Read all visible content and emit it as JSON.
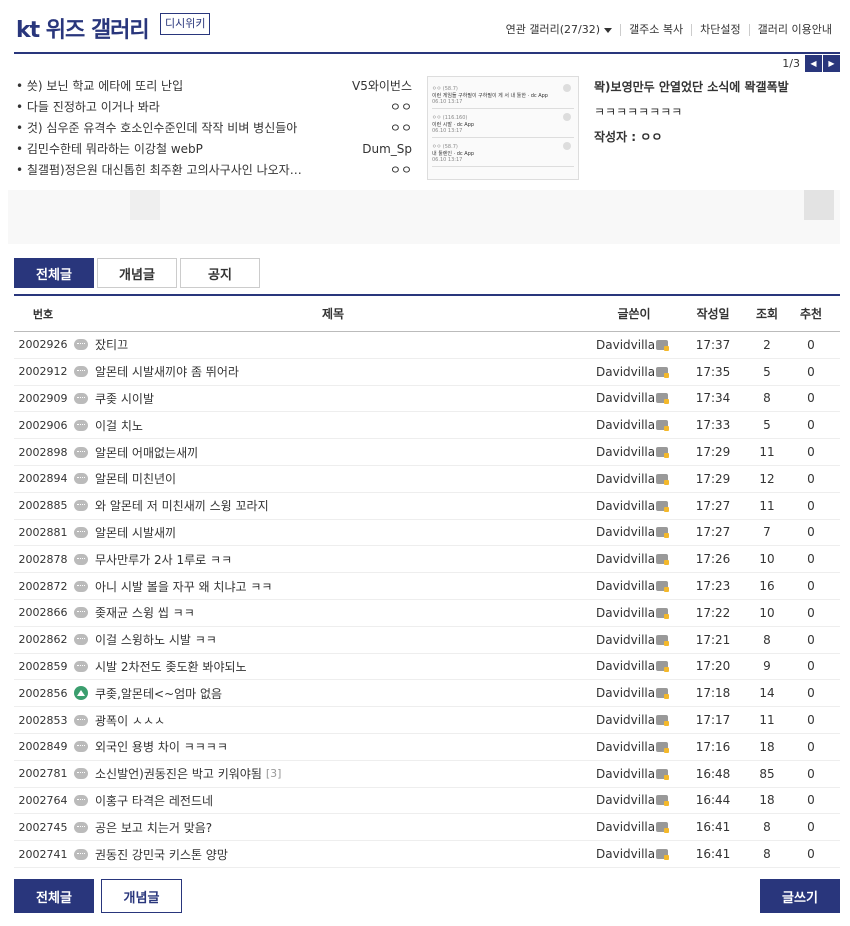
{
  "header": {
    "title": "kt 위즈 갤러리",
    "wiki_badge": "디시위키",
    "links": [
      "연관 갤러리(27/32)",
      "갤주소 복사",
      "차단설정",
      "갤러리 이용안내"
    ]
  },
  "pager": {
    "count": "1/3"
  },
  "hot_posts": [
    {
      "title": "• 씃) 보닌 학교 에타에 또리 난입",
      "author": "V5와이번스"
    },
    {
      "title": "• 다들 진정하고 이거나 봐라",
      "author": "ㅇㅇ"
    },
    {
      "title": "• 것) 심우준 유격수 호소인수준인데 작작 비벼 병신들아",
      "author": "ㅇㅇ"
    },
    {
      "title": "• 김민수한테 뭐라하는 이강철 webP",
      "author": "Dum_Sp"
    },
    {
      "title": "• 칠갤펌)정은원 대신톱힌 최주환 고의사구사인 나오자…",
      "author": "ㅇㅇ"
    }
  ],
  "thumb_cards": [
    {
      "l1": "ㅇㅇ (58.7)",
      "l2": "이런 게임들 구하필이 구하필이 게 서 내 툴한 · dc App",
      "l3": "06.10 13:17"
    },
    {
      "l1": "ㅇㅇ (116.160)",
      "l2": "이런 시발 · dc App",
      "l3": "06.10 13:17"
    },
    {
      "l1": "ㅇㅇ (58.7)",
      "l2": "내 툴렌인 · dc App",
      "l3": "06.10 13:17"
    }
  ],
  "feature": {
    "title": "뫅)보영만두 안열었단 소식에 뫅갤폭발",
    "body": "ㅋㅋㅋㅋㅋㅋㅋㅋ",
    "author": "작성자 : ㅇㅇ"
  },
  "tabs": [
    "전체글",
    "개념글",
    "공지"
  ],
  "columns": {
    "num": "번호",
    "subject": "제목",
    "writer": "글쓴이",
    "date": "작성일",
    "views": "조회",
    "recommend": "추천"
  },
  "rows": [
    {
      "num": "2002926",
      "subject": "잤티끄",
      "reply": "",
      "writer": "Davidvilla",
      "date": "17:37",
      "views": "2",
      "rec": "0",
      "img": false
    },
    {
      "num": "2002912",
      "subject": "알몬테 시발새끼야 좀 뛰어라",
      "reply": "",
      "writer": "Davidvilla",
      "date": "17:35",
      "views": "5",
      "rec": "0",
      "img": false
    },
    {
      "num": "2002909",
      "subject": "쿠좆 시이발",
      "reply": "",
      "writer": "Davidvilla",
      "date": "17:34",
      "views": "8",
      "rec": "0",
      "img": false
    },
    {
      "num": "2002906",
      "subject": "이걸 치노",
      "reply": "",
      "writer": "Davidvilla",
      "date": "17:33",
      "views": "5",
      "rec": "0",
      "img": false
    },
    {
      "num": "2002898",
      "subject": "알몬테 어매없는새끼",
      "reply": "",
      "writer": "Davidvilla",
      "date": "17:29",
      "views": "11",
      "rec": "0",
      "img": false
    },
    {
      "num": "2002894",
      "subject": "알몬테 미친년이",
      "reply": "",
      "writer": "Davidvilla",
      "date": "17:29",
      "views": "12",
      "rec": "0",
      "img": false
    },
    {
      "num": "2002885",
      "subject": "와 알몬테 저 미친새끼 스윙 꼬라지",
      "reply": "",
      "writer": "Davidvilla",
      "date": "17:27",
      "views": "11",
      "rec": "0",
      "img": false
    },
    {
      "num": "2002881",
      "subject": "알몬테 시발새끼",
      "reply": "",
      "writer": "Davidvilla",
      "date": "17:27",
      "views": "7",
      "rec": "0",
      "img": false
    },
    {
      "num": "2002878",
      "subject": "무사만루가 2사 1루로 ㅋㅋ",
      "reply": "",
      "writer": "Davidvilla",
      "date": "17:26",
      "views": "10",
      "rec": "0",
      "img": false
    },
    {
      "num": "2002872",
      "subject": "아니 시발 볼을 자꾸 왜 치냐고 ㅋㅋ",
      "reply": "",
      "writer": "Davidvilla",
      "date": "17:23",
      "views": "16",
      "rec": "0",
      "img": false
    },
    {
      "num": "2002866",
      "subject": "좆재균 스윙 씹 ㅋㅋ",
      "reply": "",
      "writer": "Davidvilla",
      "date": "17:22",
      "views": "10",
      "rec": "0",
      "img": false
    },
    {
      "num": "2002862",
      "subject": "이걸 스윙하노 시발 ㅋㅋ",
      "reply": "",
      "writer": "Davidvilla",
      "date": "17:21",
      "views": "8",
      "rec": "0",
      "img": false
    },
    {
      "num": "2002859",
      "subject": "시발 2차전도 좆도환 봐야되노",
      "reply": "",
      "writer": "Davidvilla",
      "date": "17:20",
      "views": "9",
      "rec": "0",
      "img": false
    },
    {
      "num": "2002856",
      "subject": "쿠좆,알몬테<~엄마 없음",
      "reply": "",
      "writer": "Davidvilla",
      "date": "17:18",
      "views": "14",
      "rec": "0",
      "img": true
    },
    {
      "num": "2002853",
      "subject": "광폭이 ㅅㅅㅅ",
      "reply": "",
      "writer": "Davidvilla",
      "date": "17:17",
      "views": "11",
      "rec": "0",
      "img": false
    },
    {
      "num": "2002849",
      "subject": "외국인 용병 차이 ㅋㅋㅋㅋ",
      "reply": "",
      "writer": "Davidvilla",
      "date": "17:16",
      "views": "18",
      "rec": "0",
      "img": false
    },
    {
      "num": "2002781",
      "subject": "소신발언)권동진은 박고 키워야됨",
      "reply": "[3]",
      "writer": "Davidvilla",
      "date": "16:48",
      "views": "85",
      "rec": "0",
      "img": false
    },
    {
      "num": "2002764",
      "subject": "이홍구 타격은 레전드네",
      "reply": "",
      "writer": "Davidvilla",
      "date": "16:44",
      "views": "18",
      "rec": "0",
      "img": false
    },
    {
      "num": "2002745",
      "subject": "공은 보고 치는거 맞음?",
      "reply": "",
      "writer": "Davidvilla",
      "date": "16:41",
      "views": "8",
      "rec": "0",
      "img": false
    },
    {
      "num": "2002741",
      "subject": "권동진 강민국 키스톤 양망",
      "reply": "",
      "writer": "Davidvilla",
      "date": "16:41",
      "views": "8",
      "rec": "0",
      "img": false
    }
  ],
  "bottom": {
    "all": "전체글",
    "concept": "개념글",
    "write": "글쓰기"
  },
  "colors": {
    "accent": "#29367c",
    "image_icon": "#3b9e6e",
    "gallog_badge": "#f3b82b"
  }
}
